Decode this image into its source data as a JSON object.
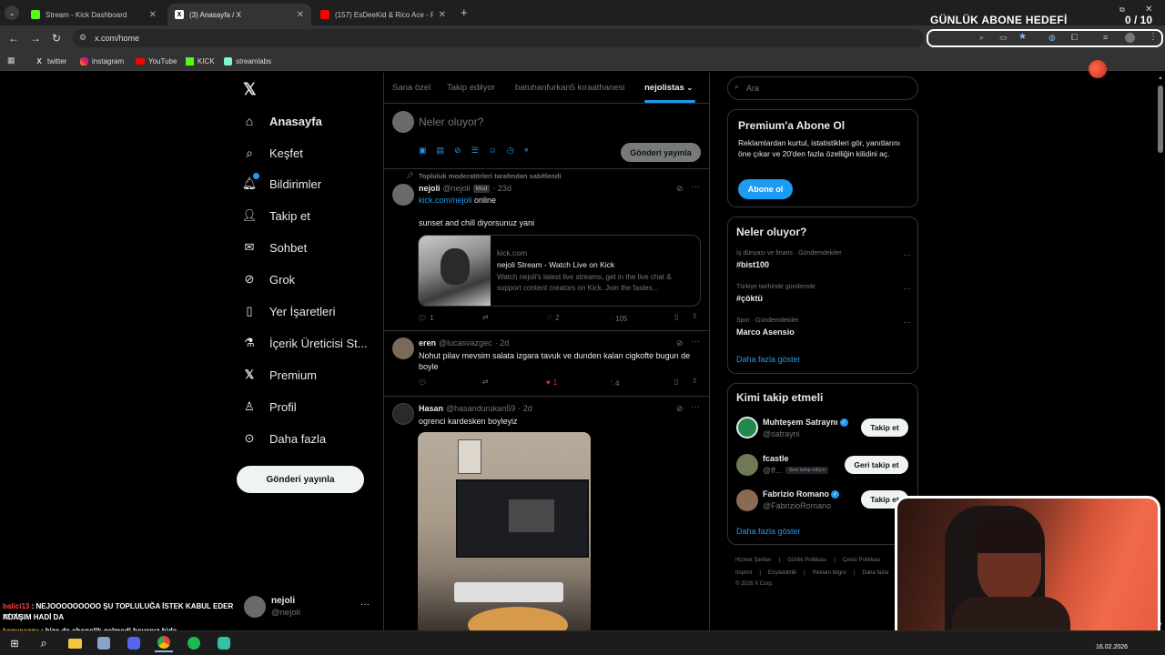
{
  "browser": {
    "tabs": [
      {
        "title": "Stream - Kick Dashboard",
        "favicon_color": "#53fc18"
      },
      {
        "title": "(3) Anasayfa / X",
        "favicon_color": "#000000"
      },
      {
        "title": "(157) EsDeeKid & Rico Ace - Ph",
        "favicon_color": "#ff0000"
      }
    ],
    "url": "x.com/home",
    "bookmarks": [
      "twitter",
      "instagram",
      "YouTube",
      "KICK",
      "streamlabs"
    ]
  },
  "overlay": {
    "abone_title": "GÜNLÜK ABONE HEDEFİ",
    "abone_count": "0 / 10"
  },
  "nav": {
    "items": [
      {
        "label": "Anasayfa",
        "icon": "home-icon"
      },
      {
        "label": "Keşfet",
        "icon": "search-icon"
      },
      {
        "label": "Bildirimler",
        "icon": "bell-icon"
      },
      {
        "label": "Takip et",
        "icon": "person-add-icon"
      },
      {
        "label": "Sohbet",
        "icon": "mail-icon"
      },
      {
        "label": "Grok",
        "icon": "grok-icon"
      },
      {
        "label": "Yer İşaretleri",
        "icon": "bookmark-icon"
      },
      {
        "label": "İçerik Üreticisi St...",
        "icon": "flask-icon"
      },
      {
        "label": "Premium",
        "icon": "x-logo-icon"
      },
      {
        "label": "Profil",
        "icon": "person-icon"
      },
      {
        "label": "Daha fazla",
        "icon": "more-circle-icon"
      }
    ],
    "post_button": "Gönderi yayınla",
    "account_name": "nejoli",
    "account_handle": "@nejoli"
  },
  "timeline": {
    "tabs": [
      "Sana özel",
      "Takip edilyor",
      "batuhanfurkan5 kıraathanesi",
      "nejolistas"
    ],
    "compose_placeholder": "Neler oluyor?",
    "compose_button": "Gönderi yayınla",
    "posts": [
      {
        "pinned_note": "Topluluk moderatörleri tarafından sabitlendi",
        "name": "nejoli",
        "handle": "@nejoli",
        "badge": "Mod",
        "time": "· 23d",
        "link": "kick.com/nejoli",
        "link_suffix": " online",
        "text": "sunset and chill diyorsunuz yani",
        "card_domain": "kick.com",
        "card_title": "nejoli Stream - Watch Live on Kick",
        "card_desc": "Watch nejoli's latest live streams, get in the live chat & support content creators on Kick. Join the fastes...",
        "replies": "1",
        "likes": "2",
        "views": "105"
      },
      {
        "name": "eren",
        "handle": "@lucasvazgec",
        "time": "· 2d",
        "text": "Nohut pilav mevsim salata izgara tavuk ve dunden kalan cigkofte bugun de boyle",
        "likes": "1",
        "views": "4"
      },
      {
        "name": "Hasan",
        "handle": "@hasandurukan59",
        "time": "· 2d",
        "text": "ogrenci kardesken boyleyiz"
      }
    ]
  },
  "sidebar": {
    "search_placeholder": "Ara",
    "premium": {
      "title": "Premium'a Abone Ol",
      "desc": "Reklamlardan kurtul, istatistikleri gör, yanıtlarını öne çıkar ve 20'den fazla özelliğin kilidini aç.",
      "button": "Abone ol"
    },
    "trends": {
      "title": "Neler oluyor?",
      "items": [
        {
          "context": "İş dünyası ve finans · Gündemdekiler",
          "topic": "#bist100"
        },
        {
          "context": "Türkiye tarihinde gündemde",
          "topic": "#çöktü"
        },
        {
          "context": "Spor · Gündemdekiler",
          "topic": "Marco Asensio"
        }
      ],
      "more": "Daha fazla göster"
    },
    "follow": {
      "title": "Kimi takip etmeli",
      "items": [
        {
          "name": "Muhteşem Satraynı",
          "handle": "@satrayni",
          "button": "Takip et",
          "verified": true
        },
        {
          "name": "fcastle",
          "handle": "@ff...",
          "note": "Seni takip ediyor",
          "button": "Geri takip et",
          "verified": false
        },
        {
          "name": "Fabrizio Romano",
          "handle": "@FabrizioRomano",
          "button": "Takip et",
          "verified": true
        }
      ],
      "more": "Daha fazla göster"
    },
    "footer": {
      "line1": [
        "Hizmet Şartları",
        "Gizlilik Politikası",
        "Çerez Politikası"
      ],
      "line2": [
        "Imprint",
        "Erişilebilirlik",
        "Reklam bilgisi",
        "Daha fazla"
      ],
      "copyright": "© 2026 X Corp."
    }
  },
  "chat": [
    {
      "user": "balici13",
      "message": " : NEJOOOOOOOOO ŞU TOPLULUĞA İSTEK KABUL EDER MİSİN",
      "cont": "ADAŞIM HADİ DA",
      "color": "#ff4040"
    },
    {
      "user": "kanyeezzy",
      "message": " : bize de abonelik gelmedi bayanız bide",
      "color": "#ffb000"
    }
  ],
  "taskbar": {
    "date": "16.02.2026"
  }
}
